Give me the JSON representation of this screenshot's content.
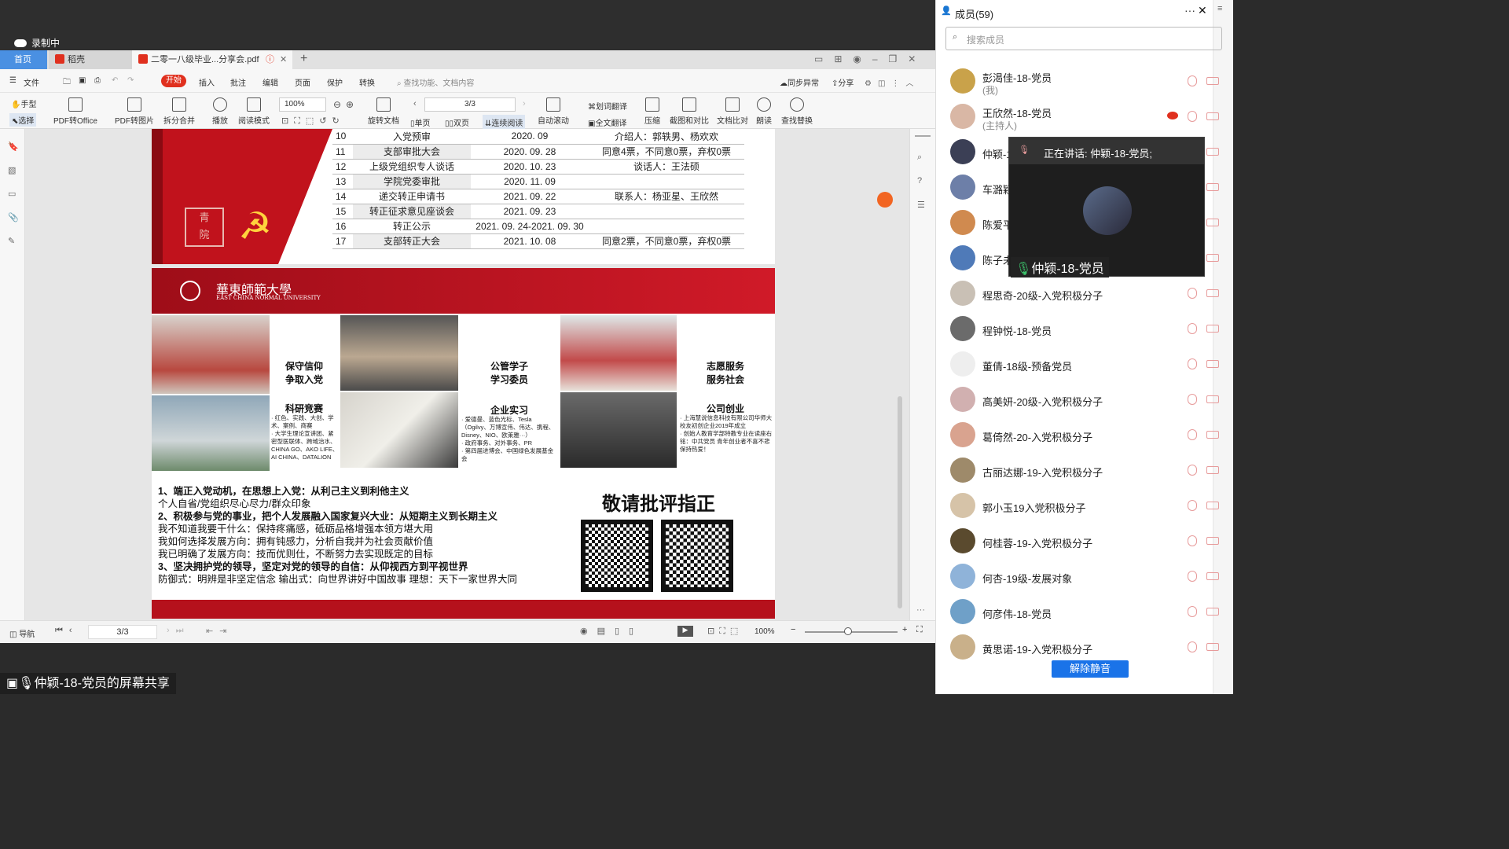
{
  "recording": {
    "label": "录制中"
  },
  "tabs": [
    {
      "label": "首页"
    },
    {
      "label": "稻壳"
    },
    {
      "label": "二零一八级毕业...分享会.pdf"
    }
  ],
  "menu": {
    "file": "文件",
    "start": "开始",
    "insert": "插入",
    "annotate": "批注",
    "edit": "编辑",
    "page": "页面",
    "protect": "保护",
    "convert": "转换",
    "search_placeholder": "查找功能、文档内容",
    "sync": "同步异常",
    "share": "分享"
  },
  "toolbar": {
    "hand": "手型",
    "select": "选择",
    "pdf2office": "PDF转Office",
    "pdf2img": "PDF转图片",
    "split": "拆分合并",
    "play": "播放",
    "read_mode": "阅读模式",
    "zoom": "100%",
    "page": "3/3",
    "rotate": "旋转文档",
    "single": "单页",
    "double": "双页",
    "continuous": "连续阅读",
    "autoscroll": "自动滚动",
    "word_translate": "划词翻译",
    "full_translate": "全文翻译",
    "compress": "压缩",
    "screenshot": "截图和对比",
    "compare": "文档比对",
    "read_aloud": "朗读",
    "find_replace": "查找替换"
  },
  "table_rows": [
    {
      "no": "10",
      "step": "入党预审",
      "date": "2020. 09",
      "note": "介绍人：郭轶男、杨欢欢"
    },
    {
      "no": "11",
      "step": "支部审批大会",
      "date": "2020. 09. 28",
      "note": "同意4票，不同意0票，弃权0票"
    },
    {
      "no": "12",
      "step": "上级党组织专人谈话",
      "date": "2020. 10. 23",
      "note": "谈话人：王法硕"
    },
    {
      "no": "13",
      "step": "学院党委审批",
      "date": "2020. 11. 09",
      "note": ""
    },
    {
      "no": "14",
      "step": "递交转正申请书",
      "date": "2021. 09. 22",
      "note": "联系人：杨亚星、王欣然"
    },
    {
      "no": "15",
      "step": "转正征求意见座谈会",
      "date": "2021. 09. 23",
      "note": ""
    },
    {
      "no": "16",
      "step": "转正公示",
      "date": "2021. 09. 24-2021. 09. 30",
      "note": ""
    },
    {
      "no": "17",
      "step": "支部转正大会",
      "date": "2021. 10. 08",
      "note": "同意2票，不同意0票，弃权0票"
    }
  ],
  "slide": {
    "univ_cn": "華東師範大學",
    "univ_en": "EAST CHINA NORMAL UNIVERSITY",
    "c1": "保守信仰\n争取入党",
    "c1b": "科研竞赛",
    "c1t": "· 红色、实践、大创、学术、案例、商赛\n· 大学生理论宣讲团、紧密型医联体、跨域治水、CHINA GO、AKO LIFE、AI CHINA、DATALION",
    "c2": "公管学子\n学习委员",
    "c2b": "企业实习",
    "c2t": "· 爱德曼、蓝色光标、Tesla（Ogilvy、万博宣伟、伟达、携程、Disney、NIO、欧莱雅···）\n· 政府事务、对外事务、PR\n· 第四届进博会、中国绿色发展基金会",
    "c3": "志愿服务\n服务社会",
    "c3b": "公司创业",
    "c3t": "· 上海慧说信息科技有限公司华师大校友初创企业2019年成立\n· 创始人教育学部特教专业在读座右铭：中共党员 青年创业者不喜不悲 保持热爱！",
    "lines": [
      {
        "t": "1、端正入党动机，在思想上入党：从利己主义到利他主义",
        "b": true
      },
      {
        "t": "个人自省/党组织尽心尽力/群众印象",
        "b": false
      },
      {
        "t": "2、积极参与党的事业，把个人发展融入国家复兴大业：从短期主义到长期主义",
        "b": true
      },
      {
        "t": "我不知道我要干什么：保持疼痛感，砥砺品格增强本领方堪大用",
        "b": false
      },
      {
        "t": "我如何选择发展方向：拥有钝感力，分析自我并为社会贡献价值",
        "b": false
      },
      {
        "t": "我已明确了发展方向：技而优则仕，不断努力去实现既定的目标",
        "b": false
      },
      {
        "t": "3、坚决拥护党的领导，坚定对党的领导的自信：从仰视西方到平视世界",
        "b": true
      },
      {
        "t": "防御式：明辨是非坚定信念 输出式：向世界讲好中国故事 理想：天下一家世界大同",
        "b": false
      }
    ],
    "thanks": "敬请批评指正"
  },
  "status": {
    "nav": "导航",
    "page": "3/3",
    "zoom": "100%"
  },
  "share_label": "仲颖-18-党员的屏幕共享",
  "panel": {
    "title": "成员(59)",
    "search_placeholder": "搜索成员",
    "unmute": "解除静音",
    "speaking": "正在讲话: 仲颖-18-党员;",
    "video_name": "仲颖-18-党员",
    "members": [
      {
        "name": "彭渴佳-18-党员",
        "sub": "(我)",
        "color": "#c9a24a"
      },
      {
        "name": "王欣然-18-党员",
        "sub": "(主持人)",
        "color": "#d9b7a5"
      },
      {
        "name": "仲颖-18-党员",
        "sub": "",
        "color": "#3b3f55"
      },
      {
        "name": "车潞颖",
        "sub": "",
        "color": "#6d7fa8"
      },
      {
        "name": "陈爱平",
        "sub": "",
        "color": "#d08a4f"
      },
      {
        "name": "陈子未",
        "sub": "",
        "color": "#4f7ab8"
      },
      {
        "name": "程思奇-20级-入党积极分子",
        "sub": "",
        "color": "#c9c0b5"
      },
      {
        "name": "程钟悦-18-党员",
        "sub": "",
        "color": "#6b6b6b"
      },
      {
        "name": "董倩-18级-预备党员",
        "sub": "",
        "color": "#eee"
      },
      {
        "name": "高美妍-20级-入党积极分子",
        "sub": "",
        "color": "#d1b0b0"
      },
      {
        "name": "葛倚然-20-入党积极分子",
        "sub": "",
        "color": "#d9a38f"
      },
      {
        "name": "古丽达娜-19-入党积极分子",
        "sub": "",
        "color": "#9e8a6a"
      },
      {
        "name": "郭小玉19入党积极分子",
        "sub": "",
        "color": "#d6c3a8"
      },
      {
        "name": "何桂蓉-19-入党积极分子",
        "sub": "",
        "color": "#5a4a2e"
      },
      {
        "name": "何杏-19级-发展对象",
        "sub": "",
        "color": "#8fb3d9"
      },
      {
        "name": "何彦伟-18-党员",
        "sub": "",
        "color": "#6fa0c8"
      },
      {
        "name": "黄思诺-19-入党积极分子",
        "sub": "",
        "color": "#c9b08a"
      }
    ]
  }
}
